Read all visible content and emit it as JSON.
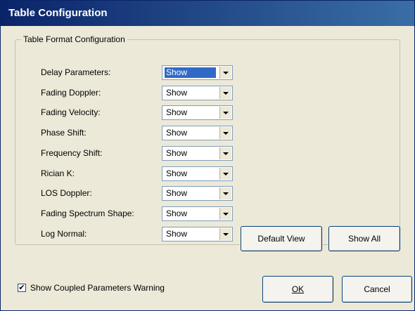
{
  "window": {
    "title": "Table Configuration"
  },
  "group": {
    "legend": "Table Format Configuration"
  },
  "rows": [
    {
      "label": "Delay Parameters:",
      "value": "Show",
      "selected": true
    },
    {
      "label": "Fading Doppler:",
      "value": "Show",
      "selected": false
    },
    {
      "label": "Fading Velocity:",
      "value": "Show",
      "selected": false
    },
    {
      "label": "Phase Shift:",
      "value": "Show",
      "selected": false
    },
    {
      "label": "Frequency Shift:",
      "value": "Show",
      "selected": false
    },
    {
      "label": "Rician K:",
      "value": "Show",
      "selected": false
    },
    {
      "label": "LOS Doppler:",
      "value": "Show",
      "selected": false
    },
    {
      "label": "Fading Spectrum Shape:",
      "value": "Show",
      "selected": false
    },
    {
      "label": "Log Normal:",
      "value": "Show",
      "selected": false
    }
  ],
  "buttons": {
    "default_view": "Default View",
    "show_all": "Show All",
    "ok": "OK",
    "cancel": "Cancel"
  },
  "warning_checkbox": {
    "label": "Show Coupled Parameters Warning",
    "checked": true
  }
}
